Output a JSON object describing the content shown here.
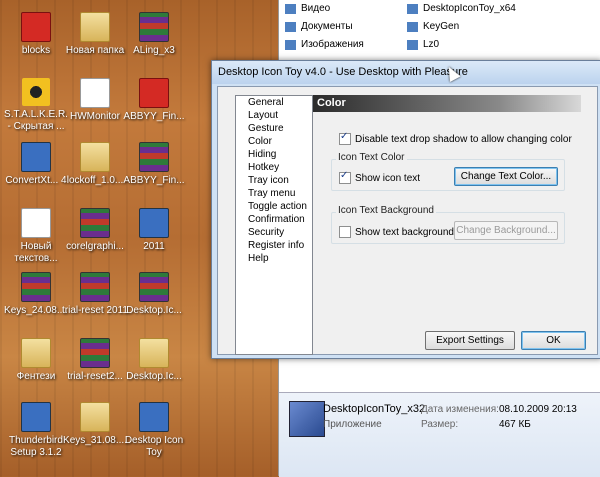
{
  "desktop": {
    "icons": [
      {
        "label": "blocks",
        "kind": "redico"
      },
      {
        "label": "Новая папка",
        "kind": "folder"
      },
      {
        "label": "ALing_x3",
        "kind": "rar"
      },
      {
        "label": "S.T.A.L.K.E.R. - Скрытая ...",
        "kind": "radio"
      },
      {
        "label": "HWMonitor",
        "kind": "docico"
      },
      {
        "label": "ABBYY_Fin...",
        "kind": "redico"
      },
      {
        "label": "ConvertXt... 4",
        "kind": "exeico"
      },
      {
        "label": "lockoff_1.0...",
        "kind": "folder"
      },
      {
        "label": "ABBYY_Fin...",
        "kind": "rar"
      },
      {
        "label": "Новый текстов...",
        "kind": "docico"
      },
      {
        "label": "corelgraphi...",
        "kind": "rar"
      },
      {
        "label": "2011",
        "kind": "exeico"
      },
      {
        "label": "Keys_24.08....",
        "kind": "rar"
      },
      {
        "label": "trial-reset 2011",
        "kind": "rar"
      },
      {
        "label": "Desktop.Ic...",
        "kind": "rar"
      },
      {
        "label": "Фентези",
        "kind": "folder"
      },
      {
        "label": "trial-reset2...",
        "kind": "rar"
      },
      {
        "label": "Desktop.Ic...",
        "kind": "folder"
      },
      {
        "label": "Thunderbird Setup 3.1.2",
        "kind": "exeico"
      },
      {
        "label": "Keys_31.08....",
        "kind": "folder"
      },
      {
        "label": "Desktop Icon Toy",
        "kind": "exeico"
      }
    ]
  },
  "explorer": {
    "nav": [
      "Видео",
      "Документы",
      "Изображения"
    ],
    "files": [
      "DesktopIconToy_x64",
      "KeyGen",
      "Lz0"
    ],
    "details": {
      "file_name": "DesktopIconToy_x32",
      "file_type": "Приложение",
      "modified_label": "Дата изменения:",
      "modified_value": "08.10.2009 20:13",
      "size_label": "Размер:",
      "size_value": "467 КБ"
    }
  },
  "dialog": {
    "title": "Desktop Icon Toy v4.0 - Use Desktop with Pleasure",
    "nav_items": [
      "General",
      "Layout",
      "Gesture",
      "Color",
      "Hiding",
      "Hotkey",
      "Tray icon",
      "Tray menu",
      "Toggle action",
      "Confirmation",
      "Security",
      "Register info",
      "Help"
    ],
    "panel_title": "Color",
    "disable_shadow_label": "Disable text drop shadow to allow changing color",
    "icon_text_color_group": "Icon Text Color",
    "show_icon_text_label": "Show icon text",
    "change_text_color_button": "Change Text Color...",
    "icon_text_bg_group": "Icon Text Background",
    "show_text_bg_label": "Show text background",
    "change_bg_button": "Change Background...",
    "export_button": "Export Settings",
    "ok_button": "OK"
  }
}
